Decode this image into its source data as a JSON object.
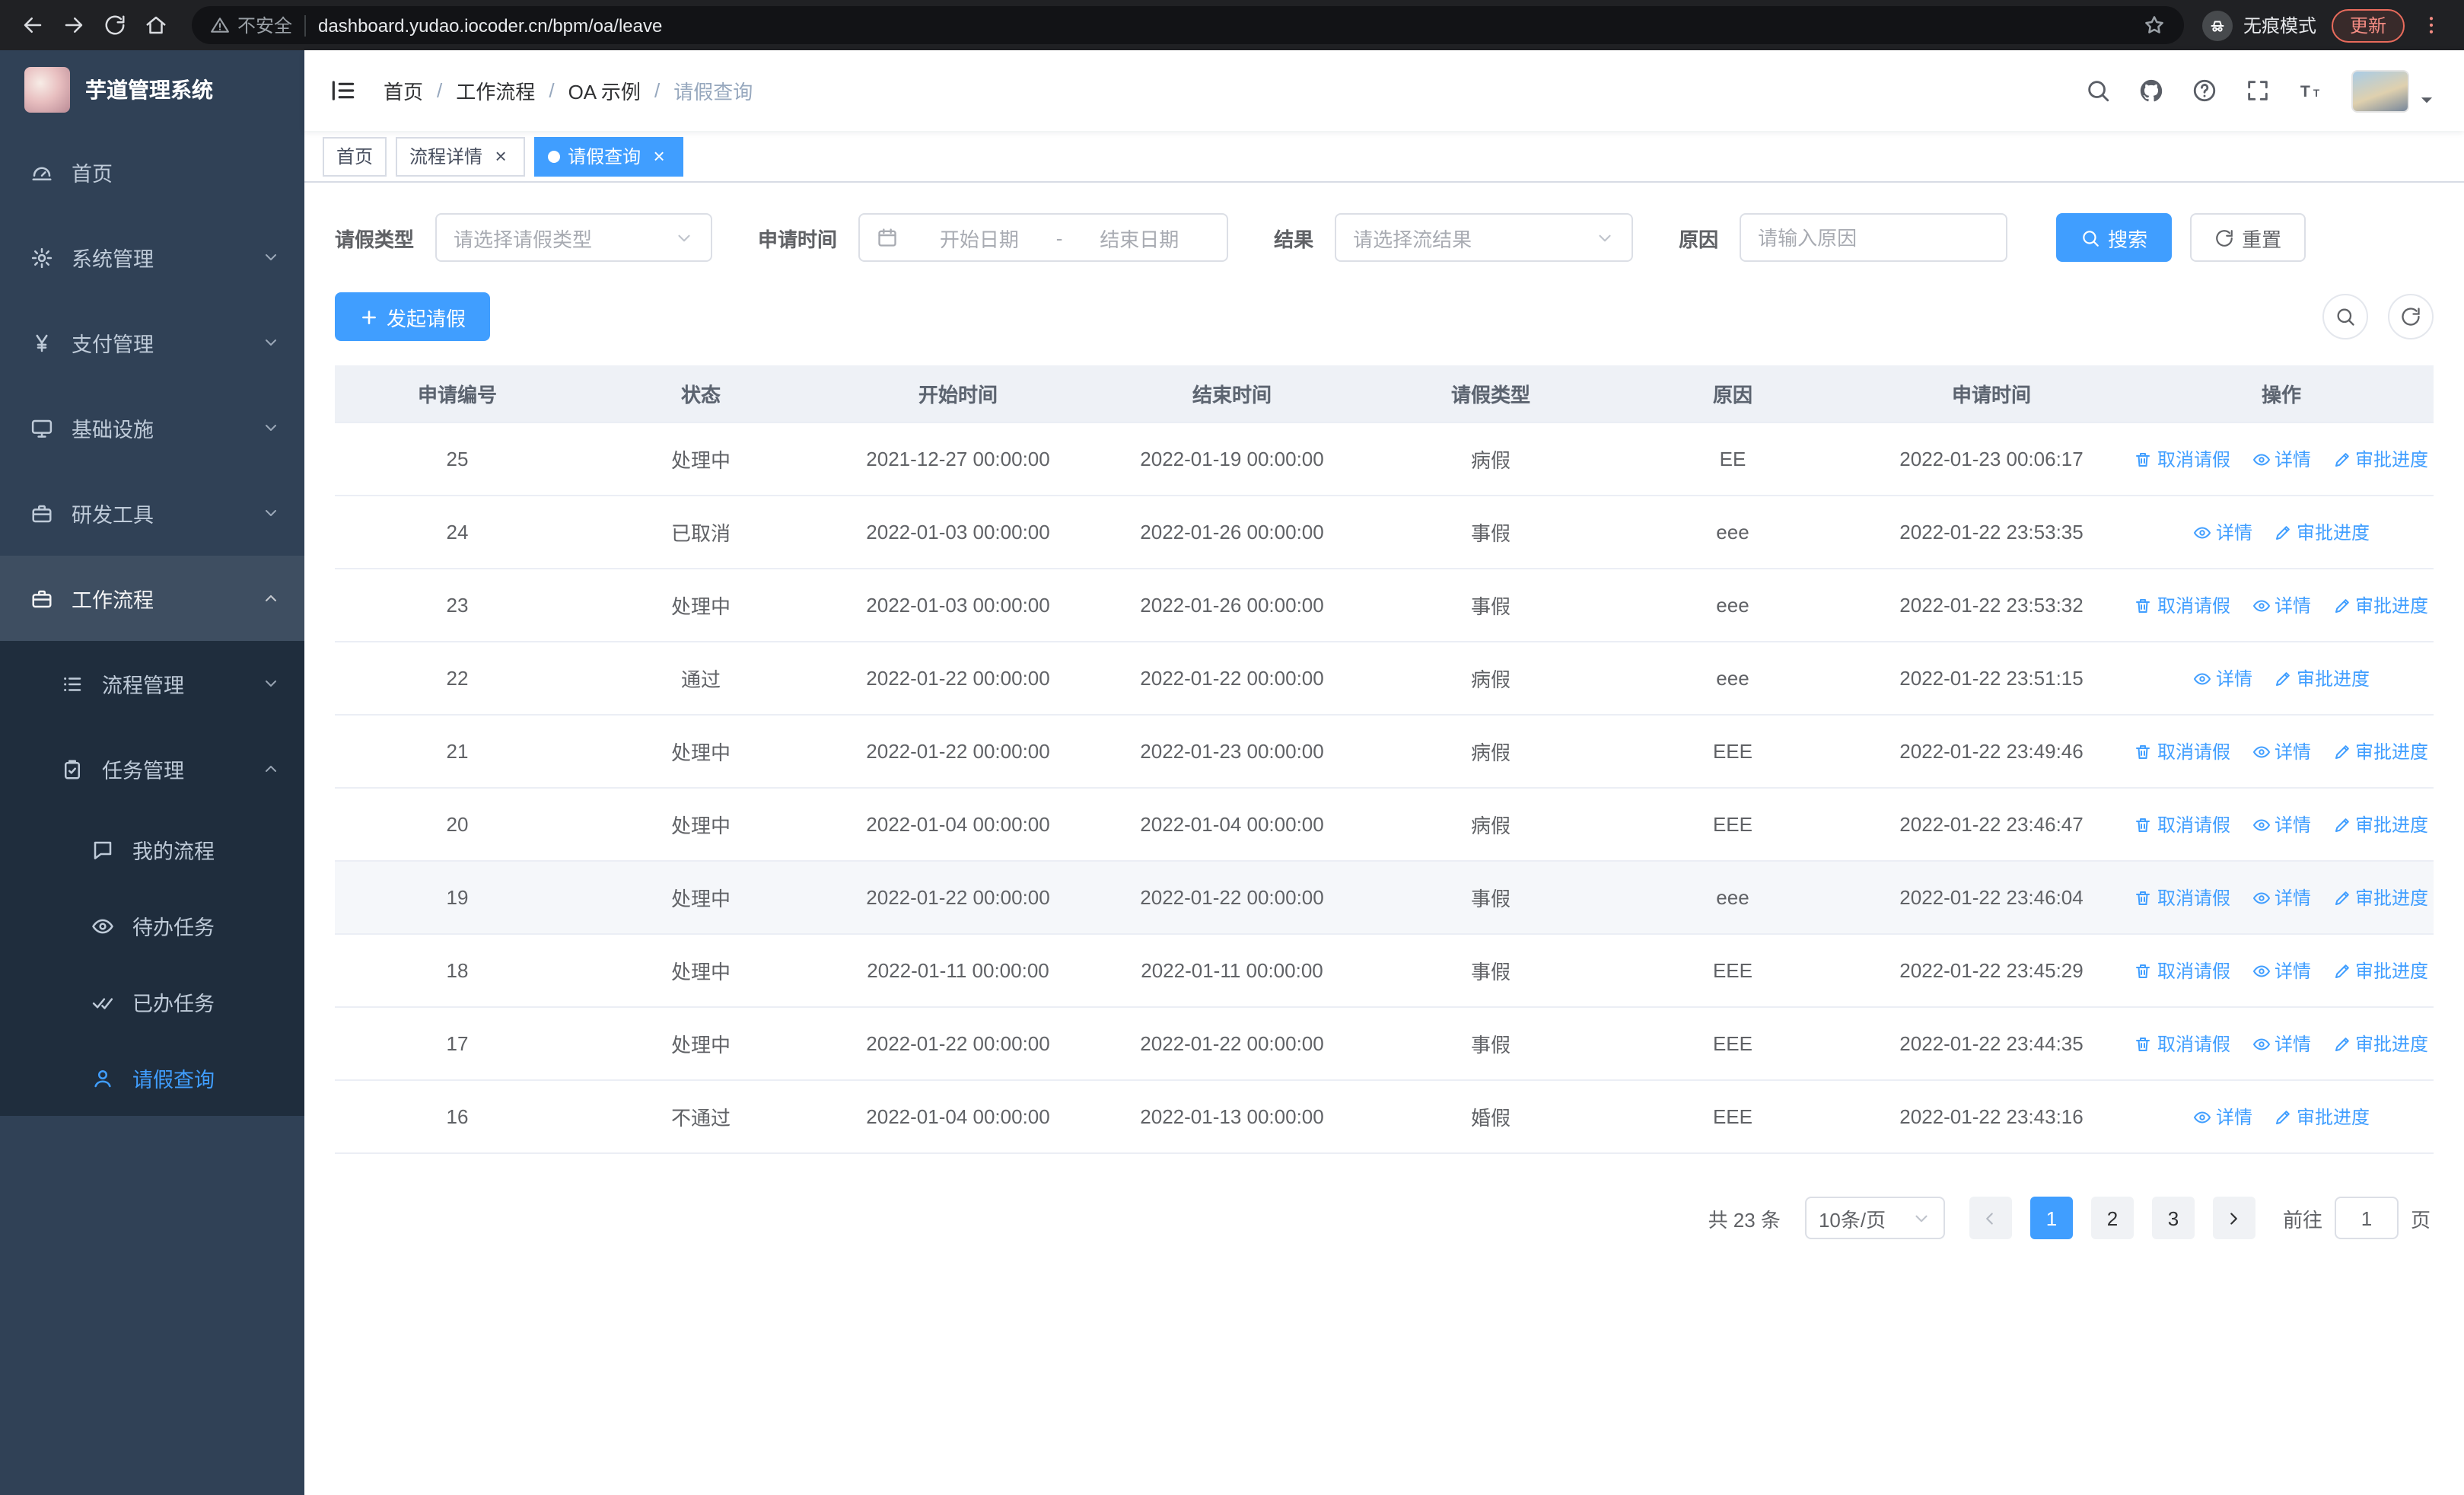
{
  "colors": {
    "primary": "#409eff",
    "sidebar_bg": "#304156",
    "submenu_bg": "#1f2d3d"
  },
  "browser": {
    "security_label": "不安全",
    "url": "dashboard.yudao.iocoder.cn/bpm/oa/leave",
    "incognito_label": "无痕模式",
    "update_label": "更新"
  },
  "sidebar": {
    "logo_title": "芋道管理系统",
    "menu": [
      {
        "name": "home",
        "label": "首页",
        "icon": "dashboard",
        "level": 1
      },
      {
        "name": "system-management",
        "label": "系统管理",
        "icon": "gear",
        "level": 1,
        "chevron": "down"
      },
      {
        "name": "payment-management",
        "label": "支付管理",
        "icon": "yen",
        "level": 1,
        "chevron": "down"
      },
      {
        "name": "infrastructure",
        "label": "基础设施",
        "icon": "monitor",
        "level": 1,
        "chevron": "down"
      },
      {
        "name": "dev-tools",
        "label": "研发工具",
        "icon": "suitcase",
        "level": 1,
        "chevron": "down"
      },
      {
        "name": "workflow",
        "label": "工作流程",
        "icon": "suitcase",
        "level": 1,
        "chevron": "up",
        "active_parent": true
      },
      {
        "name": "process-management",
        "label": "流程管理",
        "icon": "list",
        "level": 2,
        "chevron": "down"
      },
      {
        "name": "task-management",
        "label": "任务管理",
        "icon": "clipboard",
        "level": 2,
        "chevron": "up"
      },
      {
        "name": "my-process",
        "label": "我的流程",
        "icon": "chat",
        "level": 3
      },
      {
        "name": "todo-tasks",
        "label": "待办任务",
        "icon": "eye",
        "level": 3
      },
      {
        "name": "done-tasks",
        "label": "已办任务",
        "icon": "doublecheck",
        "level": 3
      },
      {
        "name": "leave-query",
        "label": "请假查询",
        "icon": "user",
        "level": 3,
        "active": true
      }
    ]
  },
  "header": {
    "breadcrumb": [
      "首页",
      "工作流程",
      "OA 示例",
      "请假查询"
    ],
    "breadcrumb_separator": "/"
  },
  "tabs": [
    {
      "name": "home",
      "label": "首页",
      "closable": false,
      "active": false
    },
    {
      "name": "process-detail",
      "label": "流程详情",
      "closable": true,
      "active": false
    },
    {
      "name": "leave-query",
      "label": "请假查询",
      "closable": true,
      "active": true
    }
  ],
  "filters": {
    "leave_type_label": "请假类型",
    "leave_type_placeholder": "请选择请假类型",
    "apply_time_label": "申请时间",
    "start_date_placeholder": "开始日期",
    "range_separator": "-",
    "end_date_placeholder": "结束日期",
    "result_label": "结果",
    "result_placeholder": "请选择流结果",
    "reason_label": "原因",
    "reason_placeholder": "请输入原因",
    "search_button": "搜索",
    "reset_button": "重置"
  },
  "toolbar": {
    "create_button": "发起请假"
  },
  "table": {
    "columns": [
      "申请编号",
      "状态",
      "开始时间",
      "结束时间",
      "请假类型",
      "原因",
      "申请时间",
      "操作"
    ],
    "actions": {
      "cancel": "取消请假",
      "detail": "详情",
      "progress": "审批进度"
    },
    "rows": [
      {
        "id": "25",
        "status": "处理中",
        "start": "2021-12-27 00:00:00",
        "end": "2022-01-19 00:00:00",
        "type": "病假",
        "reason": "EE",
        "applied": "2022-01-23 00:06:17",
        "can_cancel": true,
        "highlight": false
      },
      {
        "id": "24",
        "status": "已取消",
        "start": "2022-01-03 00:00:00",
        "end": "2022-01-26 00:00:00",
        "type": "事假",
        "reason": "eee",
        "applied": "2022-01-22 23:53:35",
        "can_cancel": false,
        "highlight": false
      },
      {
        "id": "23",
        "status": "处理中",
        "start": "2022-01-03 00:00:00",
        "end": "2022-01-26 00:00:00",
        "type": "事假",
        "reason": "eee",
        "applied": "2022-01-22 23:53:32",
        "can_cancel": true,
        "highlight": false
      },
      {
        "id": "22",
        "status": "通过",
        "start": "2022-01-22 00:00:00",
        "end": "2022-01-22 00:00:00",
        "type": "病假",
        "reason": "eee",
        "applied": "2022-01-22 23:51:15",
        "can_cancel": false,
        "highlight": false
      },
      {
        "id": "21",
        "status": "处理中",
        "start": "2022-01-22 00:00:00",
        "end": "2022-01-23 00:00:00",
        "type": "病假",
        "reason": "EEE",
        "applied": "2022-01-22 23:49:46",
        "can_cancel": true,
        "highlight": false
      },
      {
        "id": "20",
        "status": "处理中",
        "start": "2022-01-04 00:00:00",
        "end": "2022-01-04 00:00:00",
        "type": "病假",
        "reason": "EEE",
        "applied": "2022-01-22 23:46:47",
        "can_cancel": true,
        "highlight": false
      },
      {
        "id": "19",
        "status": "处理中",
        "start": "2022-01-22 00:00:00",
        "end": "2022-01-22 00:00:00",
        "type": "事假",
        "reason": "eee",
        "applied": "2022-01-22 23:46:04",
        "can_cancel": true,
        "highlight": true
      },
      {
        "id": "18",
        "status": "处理中",
        "start": "2022-01-11 00:00:00",
        "end": "2022-01-11 00:00:00",
        "type": "事假",
        "reason": "EEE",
        "applied": "2022-01-22 23:45:29",
        "can_cancel": true,
        "highlight": false
      },
      {
        "id": "17",
        "status": "处理中",
        "start": "2022-01-22 00:00:00",
        "end": "2022-01-22 00:00:00",
        "type": "事假",
        "reason": "EEE",
        "applied": "2022-01-22 23:44:35",
        "can_cancel": true,
        "highlight": false
      },
      {
        "id": "16",
        "status": "不通过",
        "start": "2022-01-04 00:00:00",
        "end": "2022-01-13 00:00:00",
        "type": "婚假",
        "reason": "EEE",
        "applied": "2022-01-22 23:43:16",
        "can_cancel": false,
        "highlight": false
      }
    ]
  },
  "pagination": {
    "total_label": "共 23 条",
    "page_size_label": "10条/页",
    "pages": [
      "1",
      "2",
      "3"
    ],
    "active_page": "1",
    "goto_label": "前往",
    "goto_value": "1",
    "page_suffix_label": "页"
  }
}
